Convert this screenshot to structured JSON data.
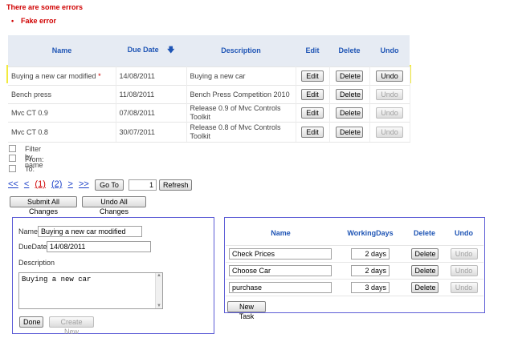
{
  "errors": {
    "title": "There are some errors",
    "items": [
      "Fake error"
    ]
  },
  "main_table": {
    "headers": {
      "name": "Name",
      "due_date": "Due Date",
      "description": "Description",
      "edit": "Edit",
      "delete": "Delete",
      "undo": "Undo"
    },
    "rows": [
      {
        "name": "Buying a new car modified",
        "marker": "*",
        "due": "14/08/2011",
        "desc": "Buying a new car",
        "edit": "Edit",
        "delete": "Delete",
        "undo": "Undo"
      },
      {
        "name": "Bench press",
        "marker": "",
        "due": "11/08/2011",
        "desc": "Bench Press Competition 2010",
        "edit": "Edit",
        "delete": "Delete",
        "undo": "Undo"
      },
      {
        "name": "Mvc CT 0.9",
        "marker": "",
        "due": "07/08/2011",
        "desc": "Release  0.9 of Mvc Controls Toolkit",
        "edit": "Edit",
        "delete": "Delete",
        "undo": "Undo"
      },
      {
        "name": "Mvc CT 0.8",
        "marker": "",
        "due": "30/07/2011",
        "desc": "Release  0.8 of Mvc Controls Toolkit",
        "edit": "Edit",
        "delete": "Delete",
        "undo": "Undo"
      }
    ]
  },
  "filters": {
    "filter_by_name": "Filter by name",
    "from": "From:",
    "to": "To:"
  },
  "pager": {
    "first": "<<",
    "prev": "<",
    "page1": "(1)",
    "page2": "(2)",
    "next": ">",
    "last": ">>",
    "goto_label": "Go To",
    "page_value": "1",
    "refresh": "Refresh"
  },
  "actions": {
    "submit_all": "Submit All Changes",
    "undo_all": "Undo All Changes"
  },
  "detail": {
    "name_label": "Name",
    "name_value": "Buying a new car modified",
    "due_label": "DueDate",
    "due_value": "14/08/2011",
    "desc_label": "Description",
    "desc_value": "Buying a new car",
    "done": "Done",
    "create_new": "Create New"
  },
  "tasks": {
    "headers": {
      "name": "Name",
      "working_days": "WorkingDays",
      "delete": "Delete",
      "undo": "Undo"
    },
    "rows": [
      {
        "name": "Check Prices",
        "days": "2 days",
        "delete": "Delete",
        "undo": "Undo"
      },
      {
        "name": "Choose Car",
        "days": "2 days",
        "delete": "Delete",
        "undo": "Undo"
      },
      {
        "name": "purchase",
        "days": "3 days",
        "delete": "Delete",
        "undo": "Undo"
      }
    ],
    "new_task": "New Task"
  },
  "colors": {
    "error": "#d00000",
    "header_blue": "#1f55b5",
    "header_bg": "#e6ebf3",
    "selection": "#f2ea3e",
    "panel_border": "#5c5cd6"
  },
  "icons": {
    "sort": "sort-arrow-down-icon",
    "required": "asterisk-icon"
  }
}
